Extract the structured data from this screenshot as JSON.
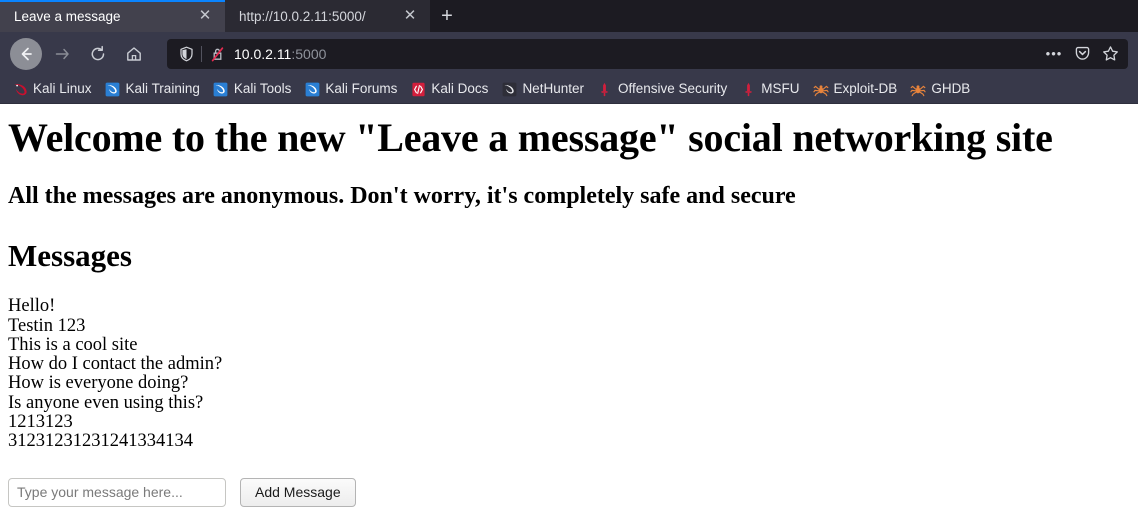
{
  "browser": {
    "tabs": [
      {
        "title": "Leave a message",
        "active": true,
        "close_label": "✕"
      },
      {
        "title": "http://10.0.2.11:5000/",
        "active": false,
        "close_label": "✕"
      }
    ],
    "new_tab_label": "+",
    "toolbar": {
      "back_title": "Back",
      "forward_title": "Forward",
      "reload_title": "Reload",
      "home_title": "Home"
    },
    "urlbar": {
      "host": "10.0.2.11",
      "port": ":5000",
      "shield_title": "Enhanced Tracking Protection",
      "insecure_title": "Connection is not secure",
      "more_label": "•••",
      "pocket_title": "Save to Pocket",
      "bookmark_title": "Bookmark this page"
    },
    "bookmarks": [
      {
        "label": "Kali Linux",
        "icon": "kali-dragon-red-icon"
      },
      {
        "label": "Kali Training",
        "icon": "kali-dragon-blue-icon"
      },
      {
        "label": "Kali Tools",
        "icon": "kali-dragon-blue-icon"
      },
      {
        "label": "Kali Forums",
        "icon": "kali-dragon-blue-icon"
      },
      {
        "label": "Kali Docs",
        "icon": "kali-docs-icon"
      },
      {
        "label": "NetHunter",
        "icon": "nethunter-dragon-icon"
      },
      {
        "label": "Offensive Security",
        "icon": "offensive-security-sword-icon"
      },
      {
        "label": "MSFU",
        "icon": "msfu-sword-icon"
      },
      {
        "label": "Exploit-DB",
        "icon": "exploit-db-spider-icon"
      },
      {
        "label": "GHDB",
        "icon": "ghdb-spider-icon"
      }
    ],
    "colors": {
      "tabstrip_bg": "#1c1b22",
      "active_tab_bg": "#42414d",
      "inactive_tab_bg": "#2b2a33",
      "toolbar_bg": "#38394a",
      "urlbar_bg": "#1c1b22",
      "accent_blue": "#0a84ff",
      "kali_red": "#c8102e",
      "kali_blue": "#2a7fd4",
      "spider_orange": "#e8843c"
    }
  },
  "page": {
    "title": "Welcome to the new \"Leave a message\" social networking site",
    "subtitle": "All the messages are anonymous. Don't worry, it's completely safe and secure",
    "messages_heading": "Messages",
    "messages": [
      "Hello!",
      "Testin 123",
      "This is a cool site",
      "How do I contact the admin?",
      "How is everyone doing?",
      "Is anyone even using this?",
      "1213123",
      "31231231231241334134"
    ],
    "form": {
      "input_value": "",
      "input_placeholder": "Type your message here...",
      "submit_label": "Add Message"
    }
  }
}
